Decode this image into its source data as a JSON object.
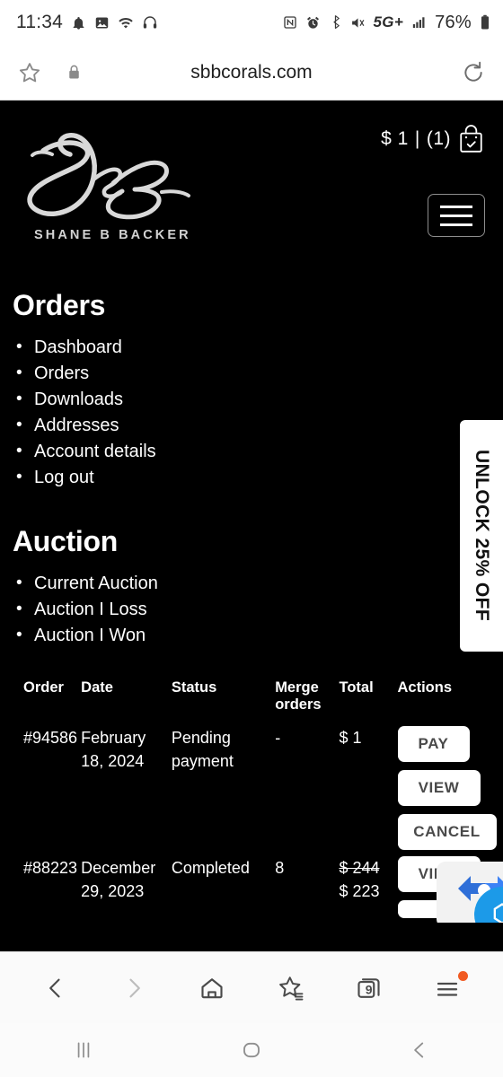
{
  "status_bar": {
    "time": "11:34",
    "battery_percent": "76%",
    "network": "5G+",
    "left_icons": [
      "notification-bell-icon",
      "image-icon",
      "wifi-icon",
      "headphones-icon"
    ],
    "right_icons": [
      "nfc-icon",
      "alarm-icon",
      "bluetooth-icon",
      "mute-icon",
      "signal-bars-icon",
      "battery-icon"
    ]
  },
  "browser": {
    "url": "sbbcorals.com",
    "star_icon": "bookmark-star-icon",
    "lock_icon": "lock-icon",
    "reload_icon": "reload-icon",
    "bottom_nav": {
      "back": "back-arrow-icon",
      "forward": "forward-arrow-icon",
      "home": "home-icon",
      "bookmarks": "bookmarks-star-icon",
      "tabs_count": "9",
      "menu": "hamburger-menu-icon"
    }
  },
  "site": {
    "logo": {
      "signature": "SBB",
      "name": "SHANE B BACKER"
    },
    "cart": {
      "amount": "$ 1",
      "separator": "|",
      "count": "(1)",
      "icon": "shopping-bag-icon"
    },
    "menu_button": "hamburger-menu-icon",
    "promo_tab": {
      "label": "UNLOCK 25% OFF"
    },
    "account_nav": {
      "orders_title": "Orders",
      "orders_items": [
        "Dashboard",
        "Orders",
        "Downloads",
        "Addresses",
        "Account details",
        "Log out"
      ],
      "auction_title": "Auction",
      "auction_items": [
        "Current Auction",
        "Auction I Loss",
        "Auction I Won"
      ]
    },
    "orders_table": {
      "columns": [
        "Order",
        "Date",
        "Status",
        "Merge orders",
        "Total",
        "Actions"
      ],
      "rows": [
        {
          "order": "#94586",
          "date": "February 18, 2024",
          "status": "Pending payment",
          "merge_orders": "-",
          "total": "$ 1",
          "total_original": "",
          "actions": [
            "PAY",
            "VIEW",
            "CANCEL"
          ]
        },
        {
          "order": "#88223",
          "date": "December 29, 2023",
          "status": "Completed",
          "merge_orders": "8",
          "total": "$ 223",
          "total_original": "$ 244",
          "actions": [
            "VIEW"
          ]
        }
      ]
    },
    "chat_widget": "support-chat-widget"
  },
  "android_nav": {
    "recents": "recents-icon",
    "home": "home-circle-icon",
    "back": "back-chevron-icon"
  },
  "colors": {
    "site_background": "#000000",
    "accent_white": "#ffffff",
    "badge_orange": "#f15a22",
    "chat_blue": "#1c9ae8"
  }
}
